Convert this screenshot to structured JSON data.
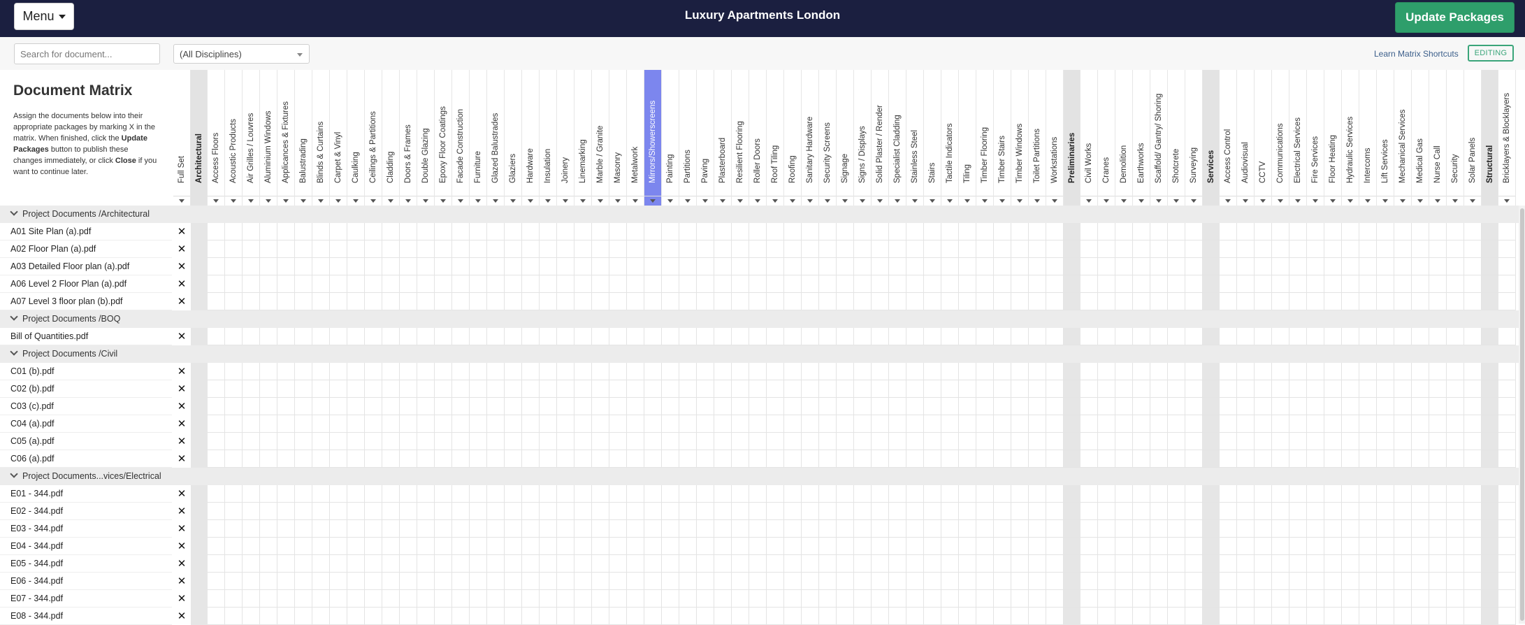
{
  "header": {
    "menu_label": "Menu",
    "project_title": "Luxury Apartments London",
    "update_label": "Update Packages"
  },
  "toolbar": {
    "search_placeholder": "Search for document...",
    "discipline_value": "(All Disciplines)",
    "shortcuts_label": "Learn Matrix Shortcuts",
    "mode_badge": "EDITING"
  },
  "intro": {
    "title": "Document Matrix",
    "text_1": "Assign the documents below into their appropriate packages by marking X in the matrix. When finished, click the ",
    "bold_1": "Update Packages",
    "text_2": " button to publish these changes immediately, or click ",
    "bold_2": "Close",
    "text_3": " if you want to continue later."
  },
  "columns": [
    {
      "label": "Full Set",
      "kind": "full"
    },
    {
      "label": "Architectural",
      "kind": "group"
    },
    {
      "label": "Access Floors"
    },
    {
      "label": "Acoustic Products"
    },
    {
      "label": "Air Grilles / Louvres"
    },
    {
      "label": "Aluminium Windows"
    },
    {
      "label": "Applicances & Fixtures"
    },
    {
      "label": "Balustrading"
    },
    {
      "label": "Blinds & Curtains"
    },
    {
      "label": "Carpet & Vinyl"
    },
    {
      "label": "Caulking"
    },
    {
      "label": "Ceilings & Partitions"
    },
    {
      "label": "Cladding"
    },
    {
      "label": "Doors & Frames"
    },
    {
      "label": "Double Glazing"
    },
    {
      "label": "Epoxy Floor Coatings"
    },
    {
      "label": "Facade Construction"
    },
    {
      "label": "Furniture"
    },
    {
      "label": "Glazed Balustrades"
    },
    {
      "label": "Glaziers"
    },
    {
      "label": "Hardware"
    },
    {
      "label": "Insulation"
    },
    {
      "label": "Joinery"
    },
    {
      "label": "Linemarking"
    },
    {
      "label": "Marble / Granite"
    },
    {
      "label": "Masonry"
    },
    {
      "label": "Metalwork"
    },
    {
      "label": "Mirrors/Showerscreens",
      "selected": true
    },
    {
      "label": "Painting"
    },
    {
      "label": "Partitions"
    },
    {
      "label": "Paving"
    },
    {
      "label": "Plasterboard"
    },
    {
      "label": "Resilient Flooring"
    },
    {
      "label": "Roller Doors"
    },
    {
      "label": "Roof Tiling"
    },
    {
      "label": "Roofing"
    },
    {
      "label": "Sanitary Hardware"
    },
    {
      "label": "Security Screens"
    },
    {
      "label": "Signage"
    },
    {
      "label": "Signs / Displays"
    },
    {
      "label": "Solid Plaster / Render"
    },
    {
      "label": "Specialist Cladding"
    },
    {
      "label": "Stainless Steel"
    },
    {
      "label": "Stairs"
    },
    {
      "label": "Tactile Indicators"
    },
    {
      "label": "Tiling"
    },
    {
      "label": "Timber Flooring"
    },
    {
      "label": "Timber Stairs"
    },
    {
      "label": "Timber Windows"
    },
    {
      "label": "Toilet Partitions"
    },
    {
      "label": "Workstations"
    },
    {
      "label": "Preliminaries",
      "kind": "group"
    },
    {
      "label": "Civil Works"
    },
    {
      "label": "Cranes"
    },
    {
      "label": "Demolition"
    },
    {
      "label": "Earthworks"
    },
    {
      "label": "Scaffold/ Gantry/ Shoring"
    },
    {
      "label": "Shotcrete"
    },
    {
      "label": "Surveying"
    },
    {
      "label": "Services",
      "kind": "group"
    },
    {
      "label": "Access Control"
    },
    {
      "label": "Audiovisual"
    },
    {
      "label": "CCTV"
    },
    {
      "label": "Communications"
    },
    {
      "label": "Electrical Services"
    },
    {
      "label": "Fire Services"
    },
    {
      "label": "Floor Heating"
    },
    {
      "label": "Hydraulic Services"
    },
    {
      "label": "Intercoms"
    },
    {
      "label": "Lift Services"
    },
    {
      "label": "Mechanical Services"
    },
    {
      "label": "Medical Gas"
    },
    {
      "label": "Nurse Call"
    },
    {
      "label": "Security"
    },
    {
      "label": "Solar Panels"
    },
    {
      "label": "Structural",
      "kind": "group"
    },
    {
      "label": "Bricklayers & Blocklayers"
    }
  ],
  "rows": [
    {
      "type": "group",
      "label": "Project Documents /Architectural"
    },
    {
      "type": "doc",
      "label": "A01 Site Plan (a).pdf",
      "mark": "✕"
    },
    {
      "type": "doc",
      "label": "A02 Floor Plan (a).pdf",
      "mark": "✕"
    },
    {
      "type": "doc",
      "label": "A03 Detailed Floor plan (a).pdf",
      "mark": "✕"
    },
    {
      "type": "doc",
      "label": "A06 Level 2 Floor Plan (a).pdf",
      "mark": "✕"
    },
    {
      "type": "doc",
      "label": "A07 Level 3 floor plan (b).pdf",
      "mark": "✕"
    },
    {
      "type": "group",
      "label": "Project Documents /BOQ"
    },
    {
      "type": "doc",
      "label": "Bill of Quantities.pdf",
      "mark": "✕"
    },
    {
      "type": "group",
      "label": "Project Documents /Civil"
    },
    {
      "type": "doc",
      "label": "C01 (b).pdf",
      "mark": "✕"
    },
    {
      "type": "doc",
      "label": "C02 (b).pdf",
      "mark": "✕"
    },
    {
      "type": "doc",
      "label": "C03 (c).pdf",
      "mark": "✕"
    },
    {
      "type": "doc",
      "label": "C04 (a).pdf",
      "mark": "✕"
    },
    {
      "type": "doc",
      "label": "C05 (a).pdf",
      "mark": "✕"
    },
    {
      "type": "doc",
      "label": "C06 (a).pdf",
      "mark": "✕"
    },
    {
      "type": "group",
      "label": "Project Documents...vices/Electrical"
    },
    {
      "type": "doc",
      "label": "E01 - 344.pdf",
      "mark": "✕"
    },
    {
      "type": "doc",
      "label": "E02 - 344.pdf",
      "mark": "✕"
    },
    {
      "type": "doc",
      "label": "E03 - 344.pdf",
      "mark": "✕"
    },
    {
      "type": "doc",
      "label": "E04 - 344.pdf",
      "mark": "✕"
    },
    {
      "type": "doc",
      "label": "E05 - 344.pdf",
      "mark": "✕"
    },
    {
      "type": "doc",
      "label": "E06 - 344.pdf",
      "mark": "✕"
    },
    {
      "type": "doc",
      "label": "E07 - 344.pdf",
      "mark": "✕"
    },
    {
      "type": "doc",
      "label": "E08 - 344.pdf",
      "mark": "✕"
    }
  ]
}
